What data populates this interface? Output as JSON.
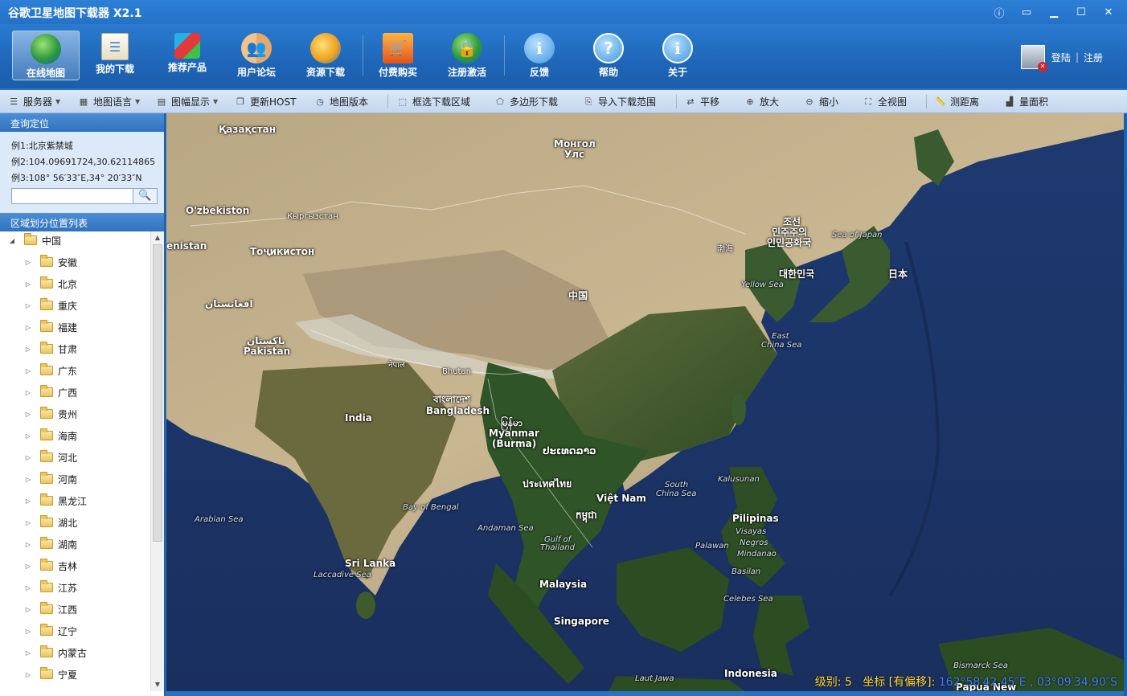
{
  "app": {
    "title": "谷歌卫星地图下载器 X2.1"
  },
  "window_buttons": [
    "info-icon",
    "minimize-to-tray-icon",
    "minimize-icon",
    "maximize-icon",
    "close-icon"
  ],
  "toolbar": {
    "items": [
      {
        "label": "在线地图",
        "icon": "globe-icon",
        "active": true
      },
      {
        "label": "我的下载",
        "icon": "download-list-icon"
      },
      {
        "label": "推荐产品",
        "icon": "cubes-icon"
      },
      {
        "label": "用户论坛",
        "icon": "users-icon"
      },
      {
        "label": "资源下载",
        "icon": "resource-globe-icon"
      },
      {
        "label": "付费购买",
        "icon": "cart-icon"
      },
      {
        "label": "注册激活",
        "icon": "lock-globe-icon"
      },
      {
        "label": "反馈",
        "icon": "feedback-icon"
      },
      {
        "label": "帮助",
        "icon": "help-icon"
      },
      {
        "label": "关于",
        "icon": "about-icon"
      }
    ],
    "login": "登陆",
    "register": "注册"
  },
  "subtoolbar": {
    "items": [
      {
        "label": "服务器",
        "dropdown": true
      },
      {
        "label": "地图语言",
        "dropdown": true
      },
      {
        "label": "图幅显示",
        "dropdown": true
      },
      {
        "label": "更新HOST"
      },
      {
        "label": "地图版本"
      },
      {
        "label": "框选下载区域"
      },
      {
        "label": "多边形下载"
      },
      {
        "label": "导入下载范围"
      },
      {
        "label": "平移"
      },
      {
        "label": "放大"
      },
      {
        "label": "缩小"
      },
      {
        "label": "全视图"
      },
      {
        "label": "测距离"
      },
      {
        "label": "量面积"
      }
    ]
  },
  "query": {
    "title": "查询定位",
    "ex1": "例1:北京紫禁城",
    "ex2": "例2:104.09691724,30.62114865",
    "ex3": "例3:108° 56′33″E,34° 20′33″N",
    "search_value": ""
  },
  "region": {
    "title": "区域划分位置列表",
    "root": "中国",
    "children": [
      "安徽",
      "北京",
      "重庆",
      "福建",
      "甘肃",
      "广东",
      "广西",
      "贵州",
      "海南",
      "河北",
      "河南",
      "黑龙江",
      "湖北",
      "湖南",
      "吉林",
      "江苏",
      "江西",
      "辽宁",
      "内蒙古",
      "宁夏"
    ]
  },
  "map": {
    "labels": [
      "Қазақстан",
      "Монгол",
      "Улс",
      "O'zbekiston",
      "Кыргызстан",
      "enistan",
      "Тоҷикистон",
      "افغانستان",
      "پاکستان",
      "Pakistan",
      "नेपाल",
      "Bhutan",
      "中国",
      "조선",
      "민주주의",
      "인민공화국",
      "Sea of Japan",
      "渤海",
      "대한민국",
      "日本",
      "Yellow Sea",
      "East",
      "China Sea",
      "India",
      "বাংলাদেশ",
      "Bangladesh",
      "မြန်မာ",
      "Myanmar",
      "(Burma)",
      "ປະເທດລາວ",
      "ประเทศไทย",
      "Việt Nam",
      "កម្ពុជា",
      "South",
      "China Sea",
      "Kalusunan",
      "Pilipinas",
      "Visayas",
      "Negros",
      "Mindanao",
      "Palawan",
      "Basilan",
      "Arabian Sea",
      "Bay of Bengal",
      "Andaman Sea",
      "Gulf of",
      "Thailand",
      "Sri Lanka",
      "Laccadive Sea",
      "Malaysia",
      "Singapore",
      "Celebes Sea",
      "Indonesia",
      "Laut Jawa",
      "Bismarck Sea",
      "Papua New"
    ]
  },
  "status": {
    "level_label": "级别",
    "level": "5",
    "coord_label": "坐标",
    "offset_label": "[有偏移]",
    "coord": "162°58′42.45″E , 03°09′34.90″S"
  }
}
